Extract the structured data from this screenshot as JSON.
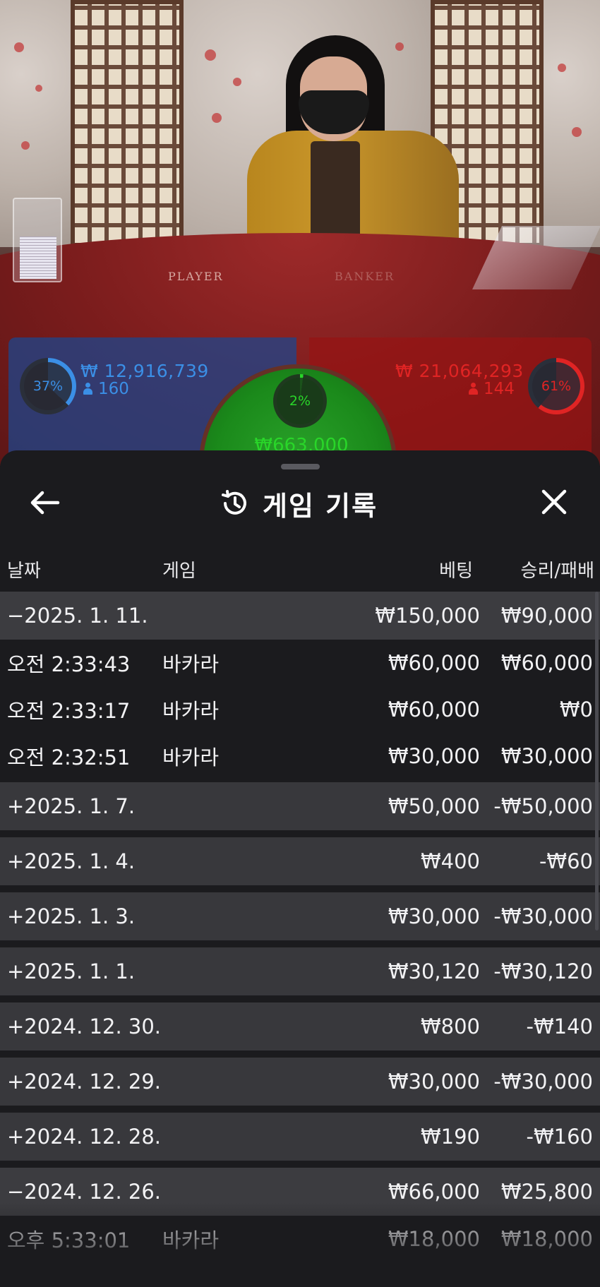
{
  "live_table": {
    "player_label": "PLAYER",
    "banker_label": "BANKER",
    "player": {
      "percent": "37%",
      "percent_value": 0.37,
      "amount": "₩ 12,916,739",
      "players": "160",
      "color": "#3b8fe6"
    },
    "banker": {
      "percent": "61%",
      "percent_value": 0.61,
      "amount": "₩ 21,064,293",
      "players": "144",
      "color": "#e02424"
    },
    "tie": {
      "percent": "2%",
      "percent_value": 0.02,
      "amount": "₩663,000",
      "color": "#29d629"
    }
  },
  "sheet": {
    "title": "게임 기록",
    "back_icon": "arrow-left-icon",
    "title_icon": "history-icon",
    "close_icon": "close-icon",
    "columns": {
      "date": "날짜",
      "game": "게임",
      "bet": "베팅",
      "result": "승리/패배"
    },
    "groups": [
      {
        "date": "−2025. 1. 11.",
        "bet": "₩150,000",
        "result": "₩90,000",
        "expanded": true,
        "details": [
          {
            "time": "오전 2:33:43",
            "game": "바카라",
            "bet": "₩60,000",
            "result": "₩60,000"
          },
          {
            "time": "오전 2:33:17",
            "game": "바카라",
            "bet": "₩60,000",
            "result": "₩0"
          },
          {
            "time": "오전 2:32:51",
            "game": "바카라",
            "bet": "₩30,000",
            "result": "₩30,000"
          }
        ]
      },
      {
        "date": "+2025. 1. 7.",
        "bet": "₩50,000",
        "result": "-₩50,000"
      },
      {
        "date": "+2025. 1. 4.",
        "bet": "₩400",
        "result": "-₩60"
      },
      {
        "date": "+2025. 1. 3.",
        "bet": "₩30,000",
        "result": "-₩30,000"
      },
      {
        "date": "+2025. 1. 1.",
        "bet": "₩30,120",
        "result": "-₩30,120"
      },
      {
        "date": "+2024. 12. 30.",
        "bet": "₩800",
        "result": "-₩140"
      },
      {
        "date": "+2024. 12. 29.",
        "bet": "₩30,000",
        "result": "-₩30,000"
      },
      {
        "date": "+2024. 12. 28.",
        "bet": "₩190",
        "result": "-₩160"
      },
      {
        "date": "−2024. 12. 26.",
        "bet": "₩66,000",
        "result": "₩25,800",
        "expanded": true,
        "details": [
          {
            "time": "오후 5:33:01",
            "game": "바카라",
            "bet": "₩18,000",
            "result": "₩18,000"
          }
        ]
      }
    ]
  }
}
